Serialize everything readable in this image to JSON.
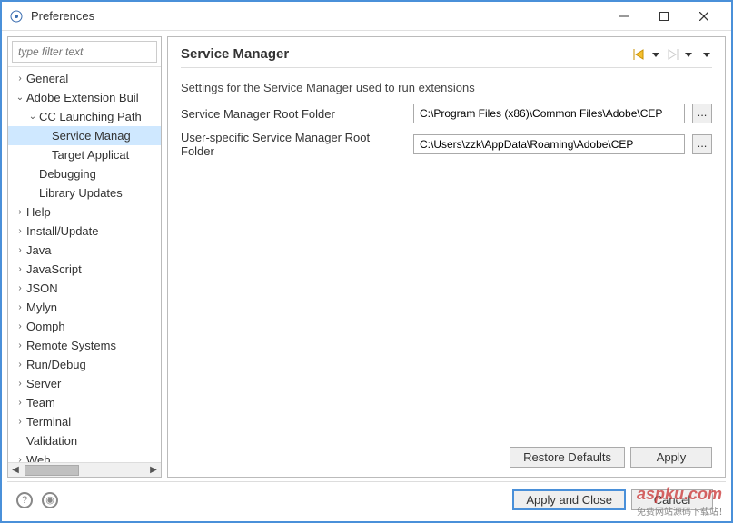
{
  "window": {
    "title": "Preferences"
  },
  "sidebar": {
    "filter_placeholder": "type filter text",
    "items": [
      {
        "label": "General",
        "indent": 0,
        "arrow": ">"
      },
      {
        "label": "Adobe Extension Buil",
        "indent": 0,
        "arrow": "v"
      },
      {
        "label": "CC Launching Path",
        "indent": 1,
        "arrow": "v"
      },
      {
        "label": "Service Manag",
        "indent": 2,
        "arrow": "",
        "selected": true
      },
      {
        "label": "Target Applicat",
        "indent": 2,
        "arrow": ""
      },
      {
        "label": "Debugging",
        "indent": 1,
        "arrow": ""
      },
      {
        "label": "Library Updates",
        "indent": 1,
        "arrow": ""
      },
      {
        "label": "Help",
        "indent": 0,
        "arrow": ">"
      },
      {
        "label": "Install/Update",
        "indent": 0,
        "arrow": ">"
      },
      {
        "label": "Java",
        "indent": 0,
        "arrow": ">"
      },
      {
        "label": "JavaScript",
        "indent": 0,
        "arrow": ">"
      },
      {
        "label": "JSON",
        "indent": 0,
        "arrow": ">"
      },
      {
        "label": "Mylyn",
        "indent": 0,
        "arrow": ">"
      },
      {
        "label": "Oomph",
        "indent": 0,
        "arrow": ">"
      },
      {
        "label": "Remote Systems",
        "indent": 0,
        "arrow": ">"
      },
      {
        "label": "Run/Debug",
        "indent": 0,
        "arrow": ">"
      },
      {
        "label": "Server",
        "indent": 0,
        "arrow": ">"
      },
      {
        "label": "Team",
        "indent": 0,
        "arrow": ">"
      },
      {
        "label": "Terminal",
        "indent": 0,
        "arrow": ">"
      },
      {
        "label": "Validation",
        "indent": 0,
        "arrow": ""
      },
      {
        "label": "Web",
        "indent": 0,
        "arrow": ">"
      }
    ]
  },
  "content": {
    "title": "Service Manager",
    "description": "Settings for the Service Manager used to run extensions",
    "fields": [
      {
        "label": "Service Manager Root Folder",
        "value": "C:\\Program Files (x86)\\Common Files\\Adobe\\CEP",
        "browse": "..."
      },
      {
        "label": "User-specific Service Manager Root Folder",
        "value": "C:\\Users\\zzk\\AppData\\Roaming\\Adobe\\CEP",
        "browse": "..."
      }
    ],
    "buttons": {
      "restore": "Restore Defaults",
      "apply": "Apply"
    }
  },
  "bottom": {
    "apply_close": "Apply and Close",
    "cancel": "Cancel"
  },
  "watermark": {
    "main": "aspku.com",
    "sub": "免费网站源码下载站！"
  }
}
